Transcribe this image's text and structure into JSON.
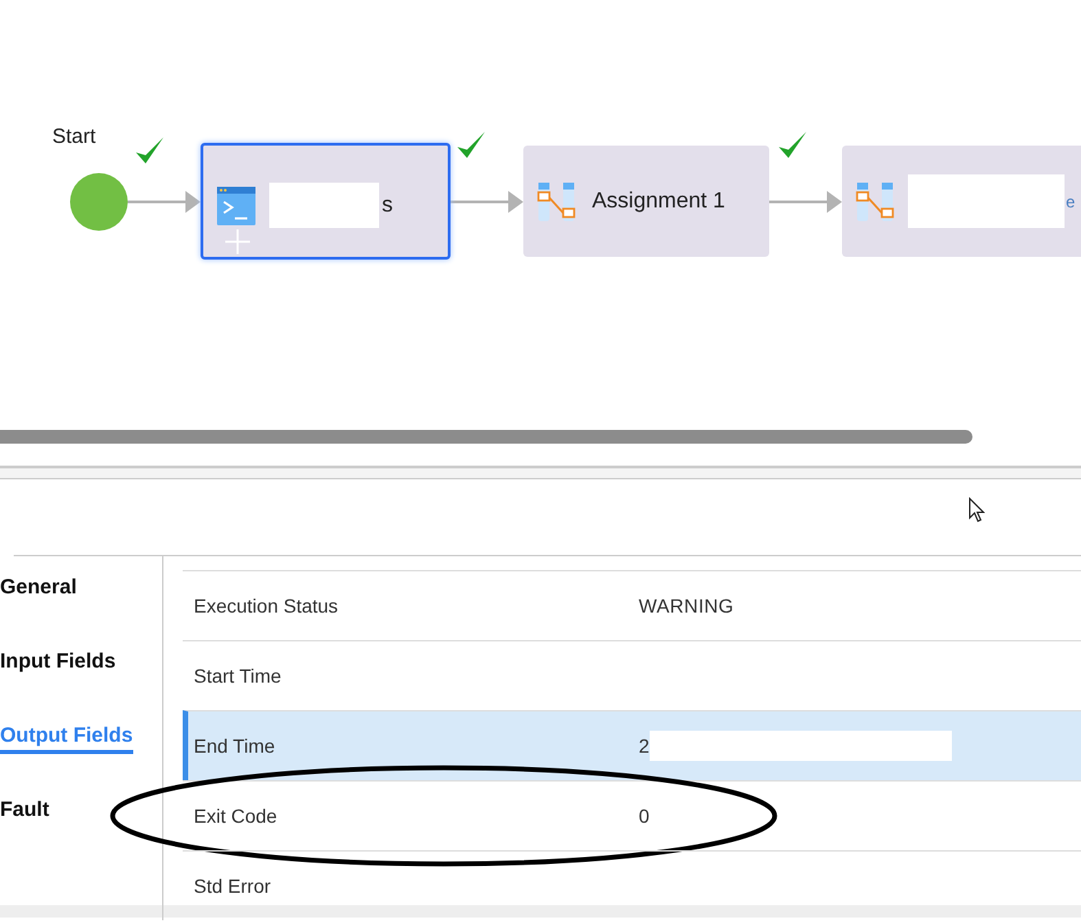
{
  "canvas": {
    "start": {
      "label": "Start",
      "validated": true
    },
    "nodes": [
      {
        "kind": "command",
        "label": "s",
        "selected": true,
        "validated": true,
        "redacted": true
      },
      {
        "kind": "assignment",
        "label": "Assignment 1",
        "selected": false,
        "validated": true,
        "redacted": false
      },
      {
        "kind": "assignment",
        "label": "e",
        "selected": false,
        "validated": false,
        "redacted": true
      }
    ]
  },
  "tabs": [
    {
      "label": "General",
      "selected": false
    },
    {
      "label": "Input Fields",
      "selected": false
    },
    {
      "label": "Output Fields",
      "selected": true
    },
    {
      "label": "Fault",
      "selected": false
    }
  ],
  "fields": [
    {
      "name": "Execution Status",
      "value": "WARNING",
      "selected": false
    },
    {
      "name": "Start Time",
      "selected": false
    },
    {
      "name": "End Time",
      "value": "2",
      "selected": true,
      "redacted": true
    },
    {
      "name": "Exit Code",
      "value": "0",
      "selected": false,
      "circled": true
    },
    {
      "name": "Std Error",
      "selected": false
    }
  ]
}
